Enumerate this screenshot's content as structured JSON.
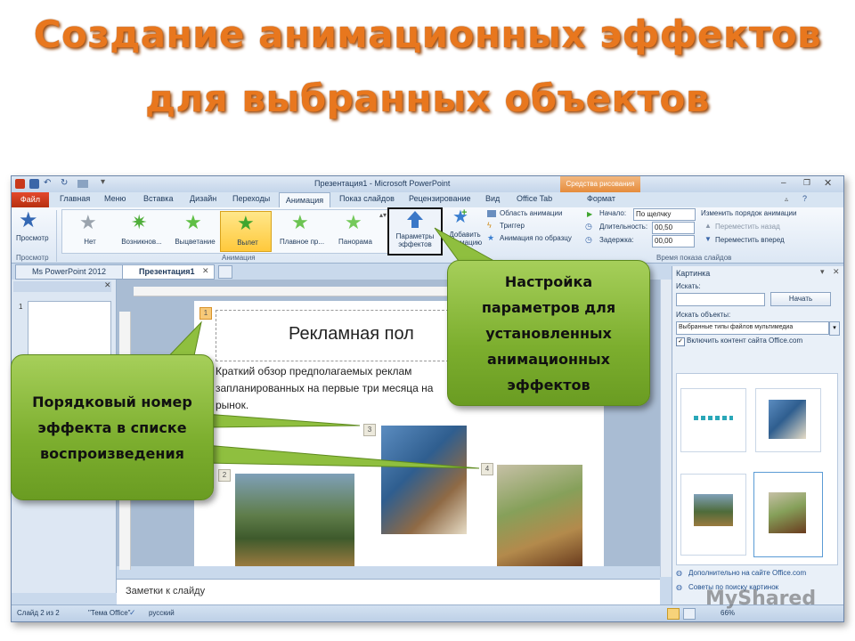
{
  "heading": {
    "line1": "Создание анимационных эффектов",
    "line2": "для выбранных объектов"
  },
  "window": {
    "title": "Презентация1 - Microsoft PowerPoint",
    "contextual_tab": "Средства рисования",
    "tabs": [
      "Файл",
      "Главная",
      "Меню",
      "Вставка",
      "Дизайн",
      "Переходы",
      "Анимация",
      "Показ слайдов",
      "Рецензирование",
      "Вид",
      "Office Tab",
      "Формат"
    ],
    "active_tab": "Анимация"
  },
  "ribbon": {
    "preview_label": "Просмотр",
    "preview_group": "Просмотр",
    "effects": [
      "Нет",
      "Возникнов...",
      "Выцветание",
      "Вылет",
      "Плавное пр...",
      "Панорама"
    ],
    "selected_effect": "Вылет",
    "animation_group": "Анимация",
    "params_button": "Параметры эффектов",
    "add_animation": "Добавить анимацию",
    "area_label": "Область анимации",
    "trigger_label": "Триггер",
    "by_sample_label": "Анимация по образцу",
    "extended_group": "Расширенная анимация",
    "start_label": "Начало:",
    "start_value": "По щелчку",
    "duration_label": "Длительность:",
    "duration_value": "00,50",
    "delay_label": "Задержка:",
    "delay_value": "00,00",
    "reorder_title": "Изменить порядок анимации",
    "move_back": "Переместить назад",
    "move_forward": "Переместить вперед",
    "timing_group": "Время показа слайдов"
  },
  "doc_tabs": [
    "Ms PowerPoint 2012",
    "Презентация1"
  ],
  "slide": {
    "title": "Рекламная пол",
    "body": "Краткий обзор предполагаемых реклам запланированных на первые три месяца на рынок.",
    "tags": [
      "1",
      "2",
      "3",
      "4"
    ],
    "thumb_number": "1"
  },
  "notes_placeholder": "Заметки к слайду",
  "taskpane": {
    "title": "Картинка",
    "search_label": "Искать:",
    "search_value": "",
    "go_button": "Начать",
    "filter_label": "Искать объекты:",
    "filter_value": "Выбранные типы файлов мультимедиа",
    "include_office": "Включить контент сайта Office.com",
    "more_link": "Дополнительно на сайте Office.com",
    "tips_link": "Советы по поиску картинок"
  },
  "status": {
    "slide": "Слайд 2 из 2",
    "theme": "\"Тема Office\"",
    "language": "русский",
    "zoom": "66%"
  },
  "watermark": "MyShared",
  "callouts": {
    "params": "Настройка параметров для установленных анимационных эффектов",
    "order": "Порядковый номер эффекта в списке воспроизведения"
  },
  "colors": {
    "title_orange": "#e8771e",
    "callout_green": "#8fbf3f",
    "ribbon_blue": "#dce7f4"
  }
}
